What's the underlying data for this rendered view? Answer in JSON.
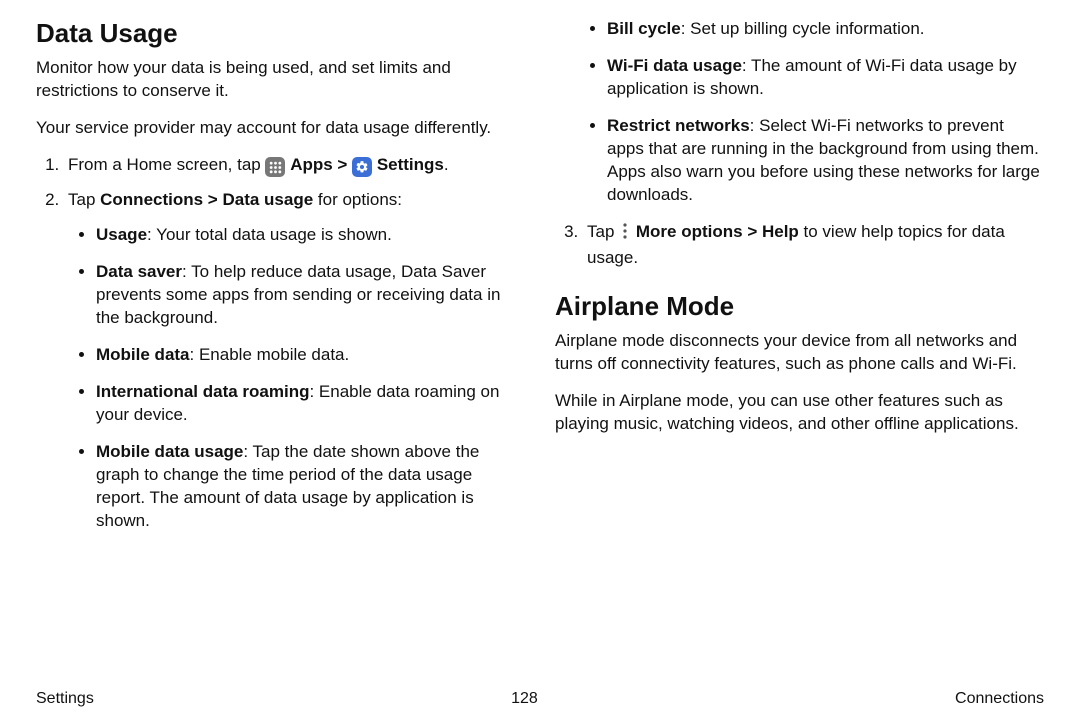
{
  "leftColumn": {
    "heading": "Data Usage",
    "intro1": "Monitor how your data is being used, and set limits and restrictions to conserve it.",
    "intro2": "Your service provider may account for data usage differently.",
    "step1_before": "From a Home screen, tap ",
    "step1_apps": "Apps",
    "step1_sep": " > ",
    "step1_settings": "Settings",
    "step1_end": ".",
    "step2_before": "Tap ",
    "step2_path": "Connections > Data usage",
    "step2_after": " for options:",
    "bullets": {
      "usage_b": "Usage",
      "usage_t": ": Your total data usage is shown.",
      "datasaver_b": "Data saver",
      "datasaver_t": ": To help reduce data usage, Data Saver prevents some apps from sending or receiving data in the background.",
      "mobiledata_b": "Mobile data",
      "mobiledata_t": ": Enable mobile data.",
      "intl_b": "International data roaming",
      "intl_t": ": Enable data roaming on your device.",
      "mdu_b": "Mobile data usage",
      "mdu_t": ": Tap the date shown above the graph to change the time period of the data usage report. The amount of data usage by application is shown."
    }
  },
  "rightColumn": {
    "bullets": {
      "billcycle_b": "Bill cycle",
      "billcycle_t": ": Set up billing cycle information.",
      "wifi_b": "Wi-Fi data usage",
      "wifi_t": ": The amount of Wi-Fi data usage by application is shown.",
      "restrict_b": "Restrict networks",
      "restrict_t": ": Select Wi-Fi networks to prevent apps that are running in the background from using them. Apps also warn you before using these networks for large downloads."
    },
    "step3_before": "Tap ",
    "step3_path": "More options > Help",
    "step3_after": " to view help topics for data usage.",
    "heading2": "Airplane Mode",
    "airplane_p1": "Airplane mode disconnects your device from all networks and turns off connectivity features, such as phone calls and Wi-Fi.",
    "airplane_p2": "While in Airplane mode, you can use other features such as playing music, watching videos, and other offline applications."
  },
  "footer": {
    "left": "Settings",
    "center": "128",
    "right": "Connections"
  }
}
